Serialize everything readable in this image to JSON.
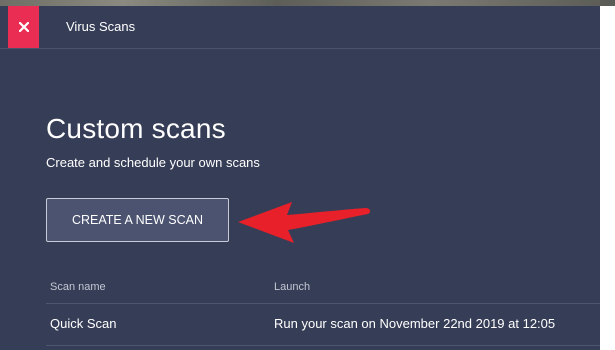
{
  "window": {
    "title": "Virus Scans",
    "close_icon": "close-icon"
  },
  "main": {
    "heading": "Custom scans",
    "subtitle": "Create and schedule your own scans",
    "create_button_label": "CREATE A NEW SCAN",
    "annotation": "red-arrow-pointing-left"
  },
  "table": {
    "columns": [
      "Scan name",
      "Launch"
    ],
    "rows": [
      {
        "name": "Quick Scan",
        "launch": "Run your scan on November 22nd 2019 at 12:05"
      }
    ]
  },
  "colors": {
    "background": "#363d56",
    "close_button": "#ea2e53",
    "button_fill": "#4b5370",
    "arrow": "#e8202a"
  }
}
